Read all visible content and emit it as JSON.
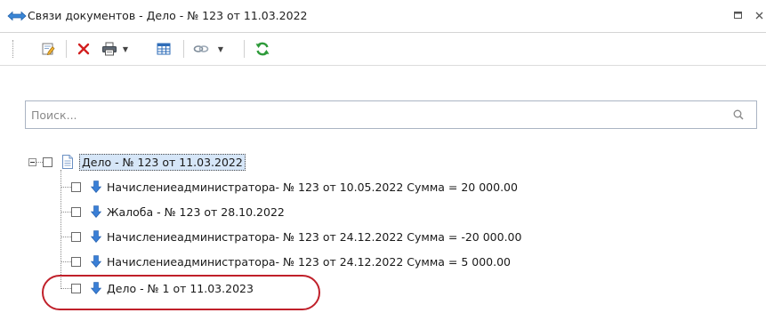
{
  "window": {
    "title": "Связи документов - Дело - № 123 от 11.03.2022",
    "title_icon": "link-arrows-icon",
    "buttons": [
      {
        "icon": "restore-icon",
        "glyph": "▫"
      },
      {
        "icon": "close-icon",
        "glyph": "✕"
      }
    ]
  },
  "toolbar": {
    "items": [
      {
        "icon": "edit-document-icon"
      },
      {
        "icon": "delete-icon"
      },
      {
        "icon": "print-icon",
        "dropdown": true
      },
      {
        "icon": "table-view-icon"
      },
      {
        "icon": "link-settings-icon",
        "dropdown": true
      },
      {
        "icon": "refresh-icon"
      }
    ]
  },
  "search": {
    "placeholder": "Поиск...",
    "value": ""
  },
  "tree": {
    "root": {
      "label": "Дело - № 123 от 11.03.2022",
      "expanded": true,
      "selected": true,
      "icon": "document-icon"
    },
    "children": [
      {
        "label": "Начислениеадминистратора- № 123 от 10.05.2022 Сумма = 20 000.00",
        "icon": "arrow-down-icon"
      },
      {
        "label": "Жалоба - № 123 от 28.10.2022",
        "icon": "arrow-down-icon"
      },
      {
        "label": "Начислениеадминистратора- № 123 от 24.12.2022 Сумма = -20 000.00",
        "icon": "arrow-down-icon"
      },
      {
        "label": "Начислениеадминистратора- № 123 от 24.12.2022 Сумма = 5 000.00",
        "icon": "arrow-down-icon"
      },
      {
        "label": "Дело - № 1 от 11.03.2023",
        "icon": "arrow-down-icon",
        "highlighted": true
      }
    ]
  },
  "colors": {
    "selection": "#d6e6f8",
    "highlight_ring": "#c0202a",
    "arrow_blue": "#2f74d0",
    "refresh_green": "#2e9b3a",
    "delete_red": "#d21f1f"
  }
}
